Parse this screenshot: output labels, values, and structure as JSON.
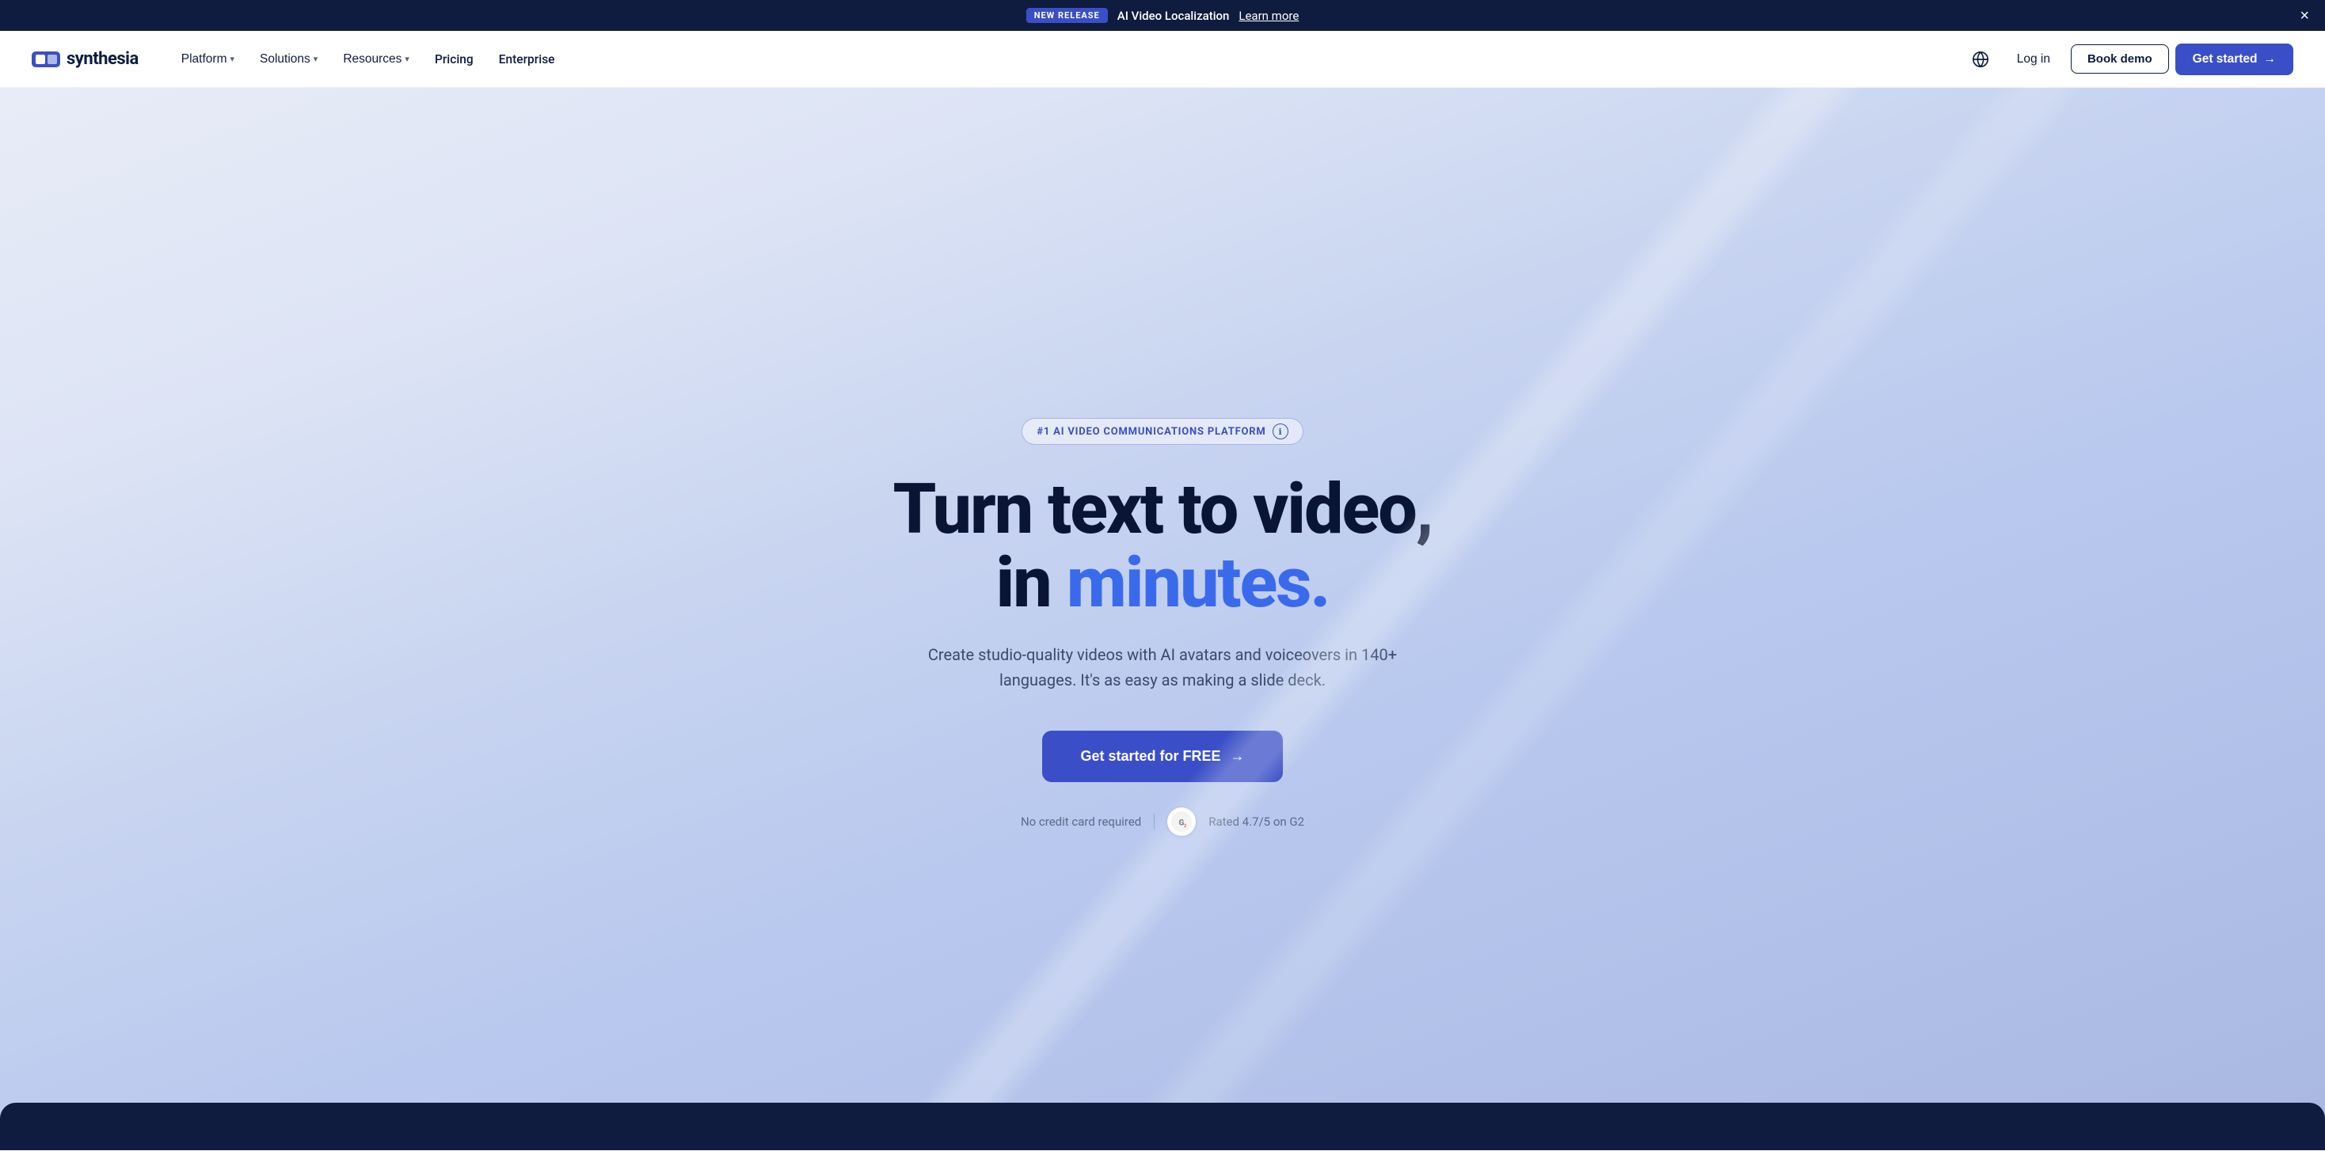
{
  "banner": {
    "badge": "NEW RELEASE",
    "text": "AI Video Localization",
    "learn_more": "Learn more",
    "close_label": "×"
  },
  "nav": {
    "logo_text": "synthesia",
    "links": [
      {
        "label": "Platform",
        "has_dropdown": true
      },
      {
        "label": "Solutions",
        "has_dropdown": true
      },
      {
        "label": "Resources",
        "has_dropdown": true
      },
      {
        "label": "Pricing",
        "has_dropdown": false
      },
      {
        "label": "Enterprise",
        "has_dropdown": false
      }
    ],
    "globe_label": "Language",
    "login": "Log in",
    "book_demo": "Book demo",
    "get_started": "Get started",
    "get_started_arrow": "→"
  },
  "hero": {
    "badge_text": "#1 AI VIDEO COMMUNICATIONS PLATFORM",
    "badge_icon": "ℹ",
    "title_line1": "Turn text to video,",
    "title_line2_prefix": "in ",
    "title_line2_highlight": "minutes.",
    "subtitle": "Create studio-quality videos with AI avatars and voiceovers in 140+ languages. It's as easy as making a slide deck.",
    "cta_label": "Get started for FREE",
    "cta_arrow": "→",
    "no_credit_card": "No credit card required",
    "g2_rating": "Rated 4.7/5 on G2"
  }
}
